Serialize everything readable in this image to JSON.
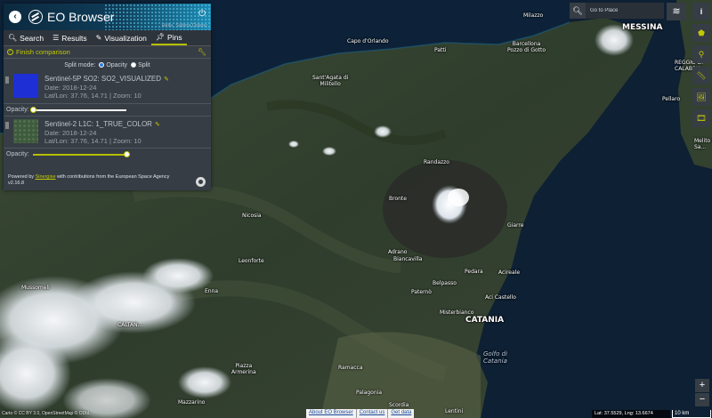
{
  "header": {
    "app_title": "EO Browser",
    "user_greeting": "Hello, Sabina Dolenc"
  },
  "tabs": [
    {
      "label": "Search"
    },
    {
      "label": "Results"
    },
    {
      "label": "Visualization"
    },
    {
      "label": "Pins",
      "active": true
    }
  ],
  "comparison": {
    "finish_label": "Finish comparison",
    "split_mode_label": "Split mode:",
    "opacity_option": "Opacity",
    "split_option": "Split",
    "selected": "Opacity"
  },
  "pins": [
    {
      "name": "Sentinel-5P SO2: SO2_VISUALIZED",
      "date": "Date: 2018-12-24",
      "location": "Lat/Lon: 37.76, 14.71 | Zoom: 10",
      "opacity_label": "Opacity:",
      "opacity": 0,
      "thumb_color": "#1f2fd6"
    },
    {
      "name": "Sentinel-2 L1C: 1_TRUE_COLOR",
      "date": "Date: 2018-12-24",
      "location": "Lat/Lon: 37.76, 14.71 | Zoom: 10",
      "opacity_label": "Opacity:",
      "opacity": 1,
      "thumb_color": "#3c5a3c"
    }
  ],
  "credits": {
    "powered_by": "Powered by",
    "sinergise": "Sinergise",
    "contrib": "with contributions from the European Space Agency",
    "version": "v2.16.8"
  },
  "search": {
    "placeholder": "Go to Place"
  },
  "map_labels": {
    "milazzo": "Milazzo",
    "messina": "MESSINA",
    "capo_orlando": "Capo d'Orlando",
    "patti": "Patti",
    "barcellona": "Barcellona\nPozzo di Gotto",
    "sant_agata": "Sant'Agata di\nMilitello",
    "reggio": "REGGIO DI\nCALABRIA",
    "pellaro": "Pellaro",
    "melito": "Melito di\nSa...",
    "randazzo": "Randazzo",
    "bronte": "Bronte",
    "nicosia": "Nicosia",
    "giarre": "Giarre",
    "leonforte": "Leonforte",
    "adrano": "Adrano",
    "biancavilla": "Biancavilla",
    "pedara": "Pedara",
    "acireale": "Acireale",
    "belpasso": "Belpasso",
    "mussomeli": "Mussomeli",
    "enna": "Enna",
    "paterno": "Paternò",
    "aci_castello": "Aci Castello",
    "misterbianco": "Misterbianco",
    "caltan": "CALTAN...",
    "catania": "CATANIA",
    "golfo": "Golfo di\nCatania",
    "piazza": "Piazza\nArmerina",
    "ramacca": "Ramacca",
    "palagonia": "Palagonia",
    "mazzarino": "Mazzarino",
    "scordia": "Scordia",
    "lentini": "Lentini"
  },
  "footer": {
    "attribution": "Carto © CC BY 3.0, OpenStreetMap © ODbL",
    "about": "About EO Browser",
    "contact": "Contact us",
    "data": "Get data",
    "coords": "Lat: 37.5529, Lng: 13.6674",
    "scale": "10 km"
  }
}
